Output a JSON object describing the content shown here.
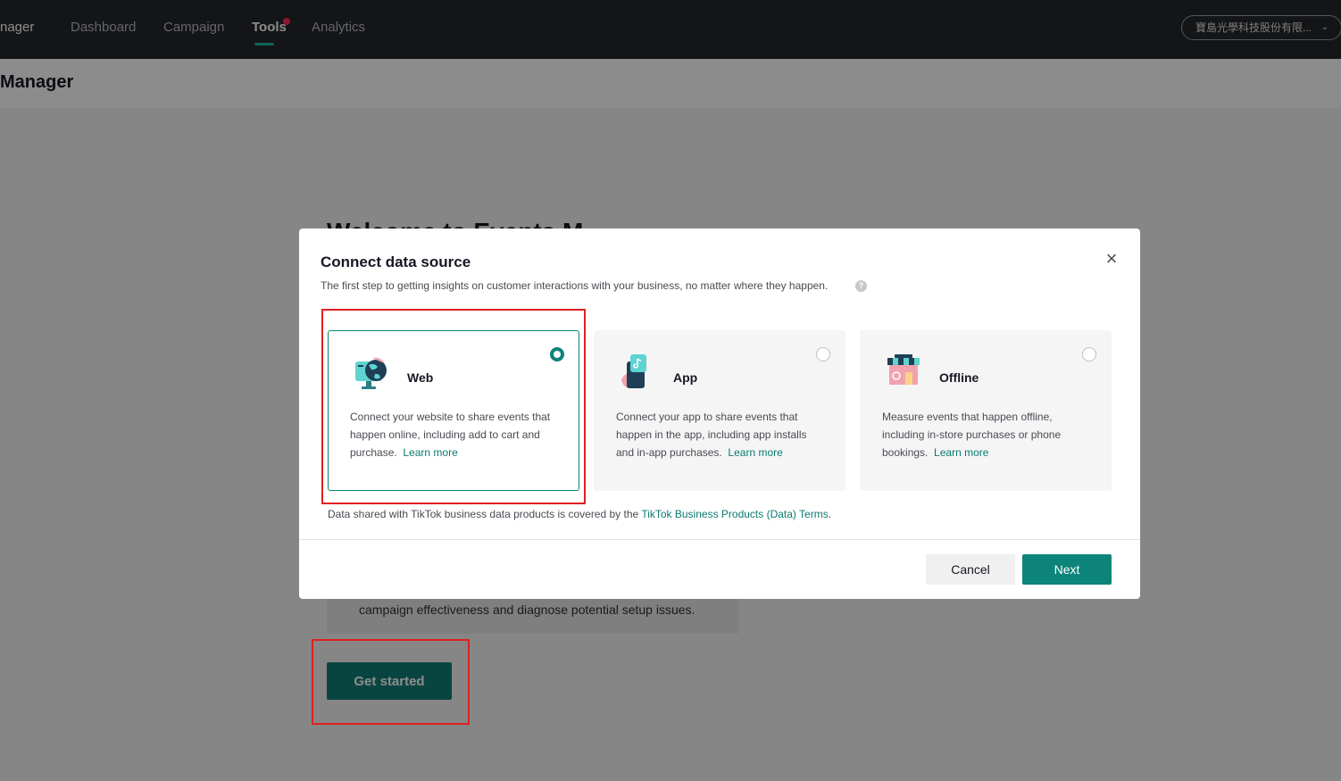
{
  "topbar": {
    "brand": "nager",
    "nav": [
      {
        "label": "Dashboard"
      },
      {
        "label": "Campaign"
      },
      {
        "label": "Tools"
      },
      {
        "label": "Analytics"
      }
    ],
    "active_index": 2,
    "account": "寶島光學科技股份有限...",
    "account_chevron": "⌄"
  },
  "page": {
    "title": "Manager",
    "welcome": "Welcome to Events M",
    "info_text": "campaign effectiveness and diagnose potential setup issues.",
    "get_started_label": "Get started"
  },
  "modal": {
    "title": "Connect data source",
    "subtitle": "The first step to getting insights on customer interactions with your business, no matter where they happen.",
    "help_glyph": "?",
    "close_glyph": "×",
    "cards": [
      {
        "label": "Web",
        "desc": "Connect your website to share events that happen online, including add to cart and purchase.",
        "link": "Learn more",
        "selected": true,
        "icon": "web-monitor-icon"
      },
      {
        "label": "App",
        "desc": "Connect your app to share events that happen in the app, including app installs and in-app purchases.",
        "link": "Learn more",
        "selected": false,
        "icon": "app-phone-icon"
      },
      {
        "label": "Offline",
        "desc": "Measure events that happen offline, including in-store purchases or phone bookings.",
        "link": "Learn more",
        "selected": false,
        "icon": "store-icon"
      }
    ],
    "terms_prefix": "Data shared with TikTok business data products is covered by the",
    "terms_link": "TikTok Business Products (Data) Terms",
    "terms_suffix": ".",
    "cancel_label": "Cancel",
    "next_label": "Next"
  },
  "colors": {
    "accent": "#0c8479",
    "nav_bg": "#25272b",
    "highlight": "#e02020",
    "notification_dot": "#fe2c55"
  }
}
